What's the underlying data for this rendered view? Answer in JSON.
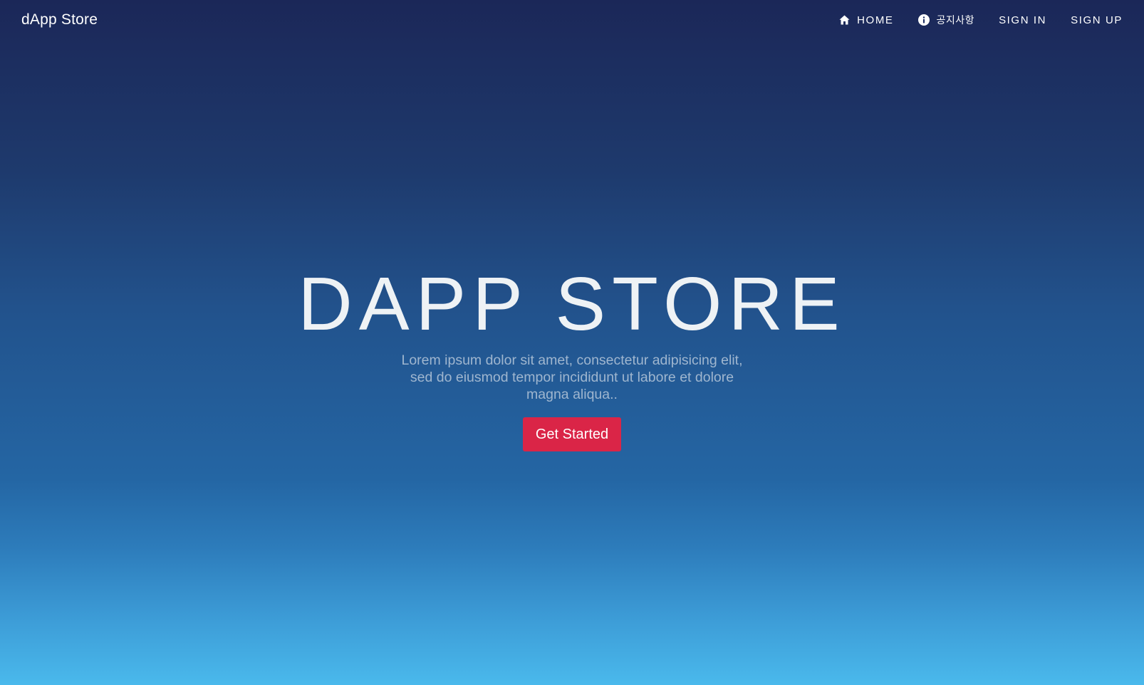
{
  "navbar": {
    "brand": "dApp Store",
    "items": [
      {
        "label": "HOME",
        "icon": "home-icon"
      },
      {
        "label": "공지사항",
        "icon": "info-icon"
      },
      {
        "label": "SIGN IN"
      },
      {
        "label": "SIGN UP"
      }
    ]
  },
  "hero": {
    "title": "DAPP STORE",
    "subtitle": "Lorem ipsum dolor sit amet, consectetur adipisicing elit, sed do eiusmod tempor incididunt ut labore et dolore magna aliqua..",
    "cta_label": "Get Started"
  },
  "colors": {
    "gradient_top": "#1b2758",
    "gradient_mid": "#2466a4",
    "gradient_bottom": "#4ab9ec",
    "cta_button": "#da2547",
    "title_text": "#eef2f5",
    "subtitle_text": "#9fb6cf"
  }
}
